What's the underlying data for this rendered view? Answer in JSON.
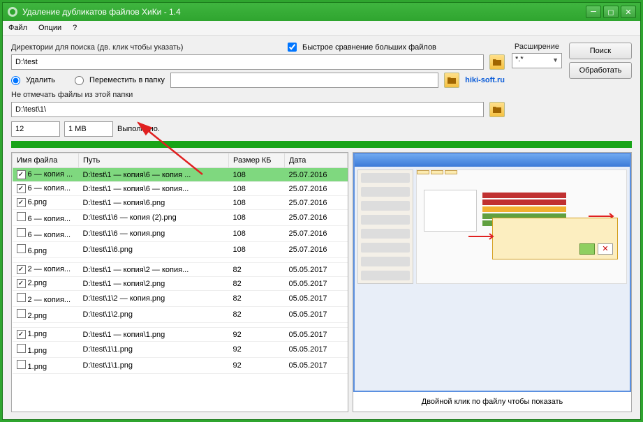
{
  "window": {
    "title": "Удаление дубликатов файлов ХиКи - 1.4"
  },
  "menu": {
    "file": "Файл",
    "options": "Опции",
    "help": "?"
  },
  "labels": {
    "dirs": "Директории для поиска (дв. клик чтобы указать)",
    "fast_compare": "Быстрое сравнение больших файлов",
    "extension": "Расширение",
    "delete": "Удалить",
    "move": "Переместить в папку",
    "exclude": "Не отмечать файлы из этой папки",
    "done": "Выполнено.",
    "preview_hint": "Двойной клик по файлу чтобы показать"
  },
  "buttons": {
    "search": "Поиск",
    "process": "Обработать"
  },
  "inputs": {
    "dir": "D:\\test",
    "move_to": "",
    "exclude_dir": "D:\\test\\1\\",
    "count": "12",
    "size": "1 MB",
    "ext": "*.*"
  },
  "link": "hiki-soft.ru",
  "table": {
    "cols": {
      "name": "Имя файла",
      "path": "Путь",
      "size": "Размер КБ",
      "date": "Дата"
    },
    "rows": [
      {
        "checked": true,
        "name": "6 — копия ...",
        "path": "D:\\test\\1 — копия\\6 — копия ...",
        "size": "108",
        "date": "25.07.2016",
        "selected": true
      },
      {
        "checked": true,
        "name": "6 — копия...",
        "path": "D:\\test\\1 — копия\\6 — копия...",
        "size": "108",
        "date": "25.07.2016"
      },
      {
        "checked": true,
        "name": "6.png",
        "path": "D:\\test\\1 — копия\\6.png",
        "size": "108",
        "date": "25.07.2016"
      },
      {
        "checked": false,
        "name": "6 — копия...",
        "path": "D:\\test\\1\\6 — копия (2).png",
        "size": "108",
        "date": "25.07.2016"
      },
      {
        "checked": false,
        "name": "6 — копия...",
        "path": "D:\\test\\1\\6 — копия.png",
        "size": "108",
        "date": "25.07.2016"
      },
      {
        "checked": false,
        "name": "6.png",
        "path": "D:\\test\\1\\6.png",
        "size": "108",
        "date": "25.07.2016"
      },
      {
        "checked": false,
        "name": "",
        "path": "",
        "size": "",
        "date": ""
      },
      {
        "checked": true,
        "name": "2 — копия...",
        "path": "D:\\test\\1 — копия\\2 — копия...",
        "size": "82",
        "date": "05.05.2017"
      },
      {
        "checked": true,
        "name": "2.png",
        "path": "D:\\test\\1 — копия\\2.png",
        "size": "82",
        "date": "05.05.2017"
      },
      {
        "checked": false,
        "name": "2 — копия...",
        "path": "D:\\test\\1\\2 — копия.png",
        "size": "82",
        "date": "05.05.2017"
      },
      {
        "checked": false,
        "name": "2.png",
        "path": "D:\\test\\1\\2.png",
        "size": "82",
        "date": "05.05.2017"
      },
      {
        "checked": false,
        "name": "",
        "path": "",
        "size": "",
        "date": ""
      },
      {
        "checked": true,
        "name": "1.png",
        "path": "D:\\test\\1 — копия\\1.png",
        "size": "92",
        "date": "05.05.2017"
      },
      {
        "checked": false,
        "name": "1.png",
        "path": "D:\\test\\1\\1.png",
        "size": "92",
        "date": "05.05.2017"
      },
      {
        "checked": false,
        "name": "1.png",
        "path": "D:\\test\\1\\1.png",
        "size": "92",
        "date": "05.05.2017"
      }
    ]
  }
}
